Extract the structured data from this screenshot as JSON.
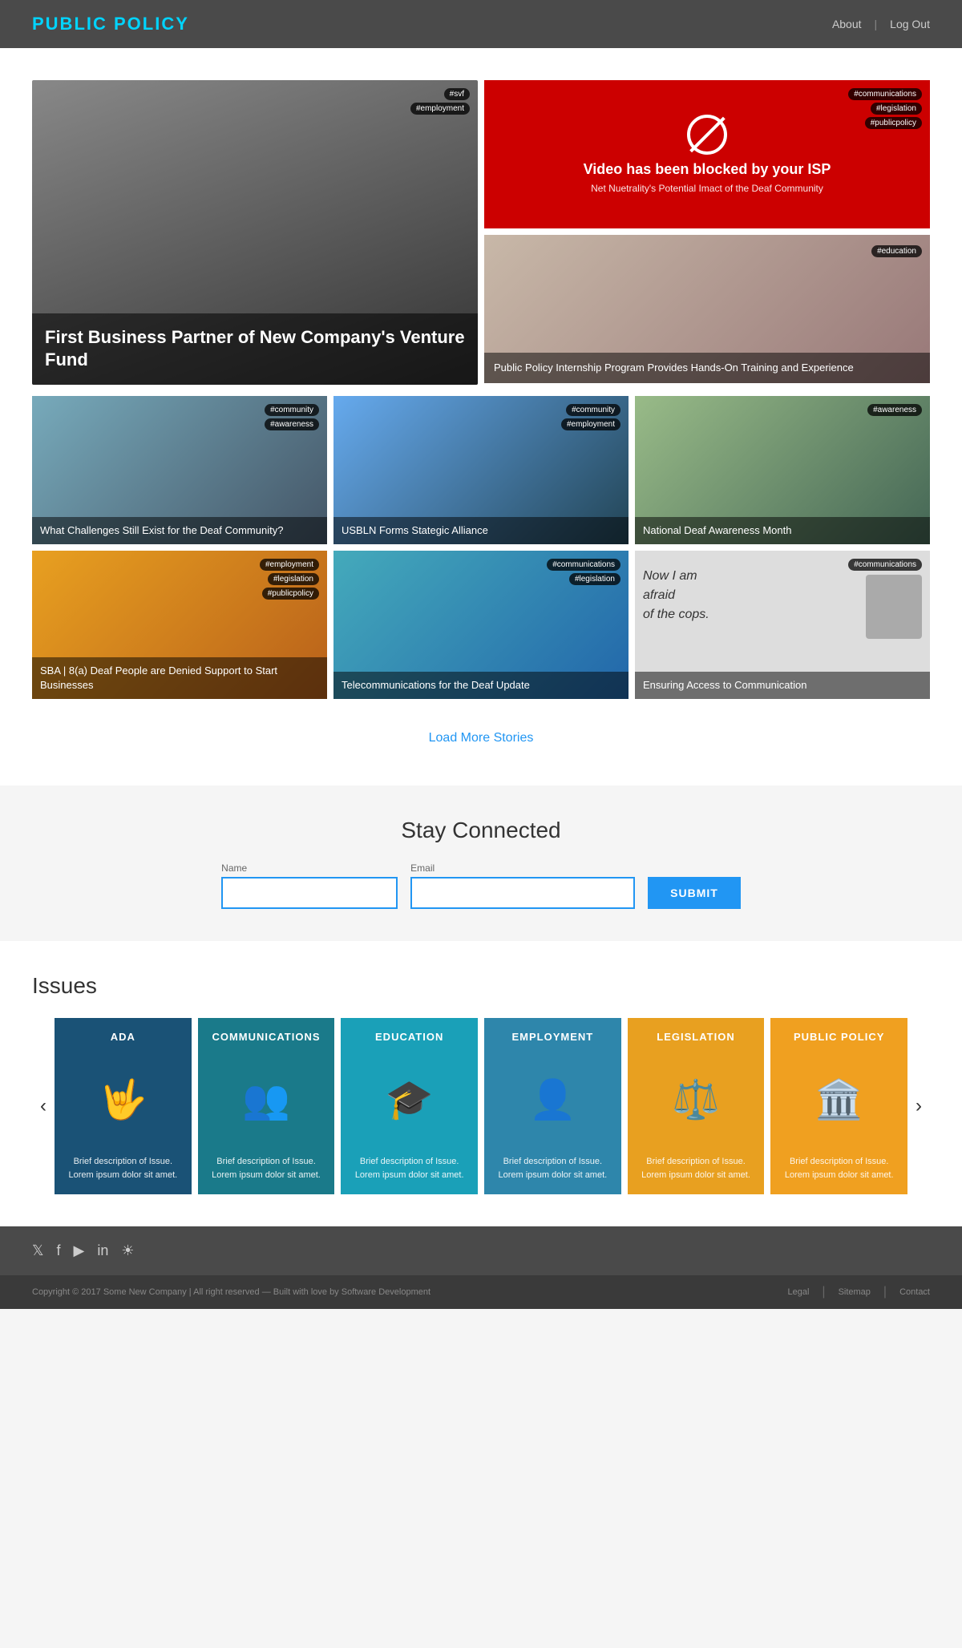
{
  "header": {
    "logo": "PUBLIC POLICY",
    "nav": {
      "about": "About",
      "divider": "|",
      "logout": "Log Out"
    }
  },
  "featured": {
    "title": "First Business Partner of New Company's Venture Fund",
    "tags": [
      "#svf",
      "#employment"
    ]
  },
  "video_blocked": {
    "title": "Video has been blocked by your ISP",
    "subtitle": "Net Nuetrality's Potential Imact of the Deaf Community",
    "tags": [
      "#communications",
      "#legislation",
      "#publicpolicy"
    ]
  },
  "education_card": {
    "title": "Public Policy Internship Program Provides Hands-On Training and Experience",
    "tag": "#education"
  },
  "mid_stories": [
    {
      "title": "What Challenges Still Exist for the Deaf Community?",
      "tags": [
        "#community",
        "#awareness"
      ],
      "bg": "bg-women-running"
    },
    {
      "title": "USBLN Forms Stategic Alliance",
      "tags": [
        "#community",
        "#employment"
      ],
      "bg": "bg-gears"
    },
    {
      "title": "National Deaf Awareness Month",
      "tags": [
        "#awareness"
      ],
      "bg": "bg-kids"
    }
  ],
  "bottom_stories": [
    {
      "title": "SBA | 8(a) Deaf People are Denied Support to Start Businesses",
      "tags": [
        "#employment",
        "#legislation",
        "#publicpolicy"
      ],
      "bg": "bg-sba"
    },
    {
      "title": "Telecommunications for the Deaf Update",
      "tags": [
        "#communications",
        "#legislation"
      ],
      "bg": "bg-telecom"
    },
    {
      "title": "Ensuring Access to Communication",
      "tags": [
        "#communications"
      ],
      "bg": "cops-card-bg",
      "subtext": "Now I am afraid of the cops."
    }
  ],
  "load_more": "Load More Stories",
  "stay_connected": {
    "title": "Stay Connected",
    "name_label": "Name",
    "email_label": "Email",
    "submit_label": "SUBMIT"
  },
  "issues": {
    "title": "Issues",
    "items": [
      {
        "label": "ADA",
        "icon": "🤟",
        "desc": "Brief description of Issue. Lorem ipsum dolor sit amet.",
        "color": "blue"
      },
      {
        "label": "COMMUNICATIONS",
        "icon": "👥",
        "desc": "Brief description of Issue. Lorem ipsum dolor sit amet.",
        "color": "teal"
      },
      {
        "label": "EDUCATION",
        "icon": "🎓",
        "desc": "Brief description of Issue. Lorem ipsum dolor sit amet.",
        "color": "cyan"
      },
      {
        "label": "EMPLOYMENT",
        "icon": "👤",
        "desc": "Brief description of Issue. Lorem ipsum dolor sit amet.",
        "color": "steel"
      },
      {
        "label": "LEGISLATION",
        "icon": "⚖️",
        "desc": "Brief description of Issue. Lorem ipsum dolor sit amet.",
        "color": "gold"
      },
      {
        "label": "PUBLIC POLICY",
        "icon": "🏛️",
        "desc": "Brief description of Issue. Lorem ipsum dolor sit amet.",
        "color": "amber"
      }
    ]
  },
  "footer": {
    "social_icons": [
      "twitter",
      "facebook",
      "youtube",
      "linkedin",
      "instagram"
    ],
    "copyright": "Copyright © 2017 Some New Company | All right reserved — Built with love by Software Development",
    "links": [
      "Legal",
      "Sitemap",
      "Contact"
    ]
  }
}
